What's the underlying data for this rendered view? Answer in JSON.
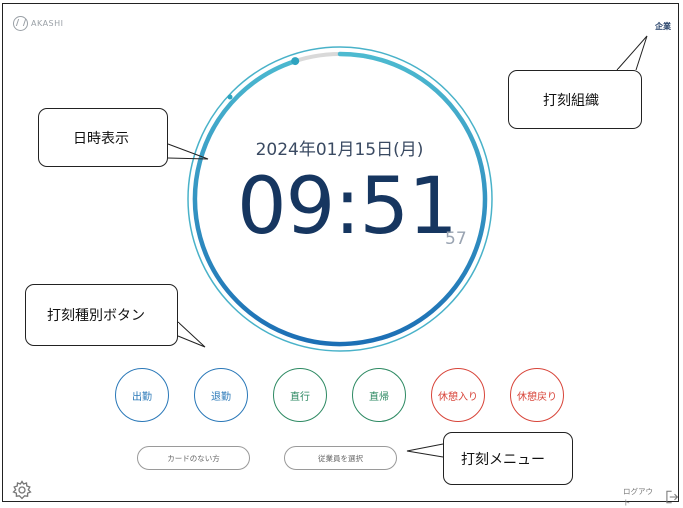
{
  "app": {
    "logo_text": "AKASHI",
    "company_label": "企業"
  },
  "clock": {
    "date": "2024年01月15日(月)",
    "time": "09:51",
    "seconds": "57",
    "second_progress": 0.95
  },
  "punch_buttons": [
    {
      "label": "出勤",
      "color": "#2a78b8"
    },
    {
      "label": "退勤",
      "color": "#2a78b8"
    },
    {
      "label": "直行",
      "color": "#2e8a63"
    },
    {
      "label": "直帰",
      "color": "#2e8a63"
    },
    {
      "label": "休憩入り",
      "color": "#d8453a"
    },
    {
      "label": "休憩戻り",
      "color": "#d8453a"
    }
  ],
  "menu": {
    "no_card": "カードのない方",
    "select_employee": "従業員を選択"
  },
  "footer": {
    "logout": "ログアウト"
  },
  "annotations": {
    "organization": "打刻組織",
    "datetime": "日時表示",
    "punch_types": "打刻種別ボタン",
    "punch_menu": "打刻メニュー"
  }
}
